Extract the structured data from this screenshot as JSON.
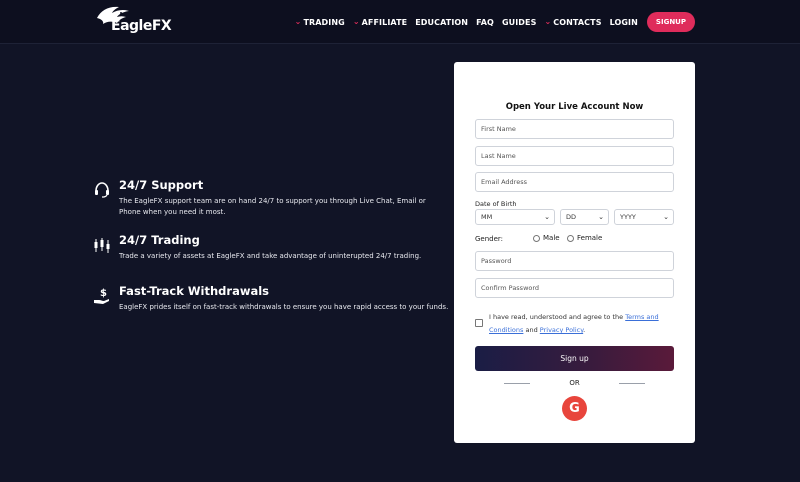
{
  "brand": {
    "name": "EagleFX"
  },
  "nav": {
    "items": [
      {
        "label": "TRADING",
        "has_dropdown": true
      },
      {
        "label": "AFFILIATE",
        "has_dropdown": true
      },
      {
        "label": "EDUCATION",
        "has_dropdown": false
      },
      {
        "label": "FAQ",
        "has_dropdown": false
      },
      {
        "label": "GUIDES",
        "has_dropdown": false
      },
      {
        "label": "CONTACTS",
        "has_dropdown": true
      },
      {
        "label": "LOGIN",
        "has_dropdown": false
      }
    ],
    "signup_label": "SIGNUP"
  },
  "features": [
    {
      "title": "24/7 Support",
      "icon": "headset-icon",
      "description": "The EagleFX support team are on hand 24/7 to support you through Live Chat, Email or Phone when you need it most."
    },
    {
      "title": "24/7 Trading",
      "icon": "candlestick-icon",
      "description": "Trade a variety of assets at EagleFX and take advantage of uninterupted 24/7 trading."
    },
    {
      "title": "Fast-Track Withdrawals",
      "icon": "dollar-hand-icon",
      "description": "EagleFX prides itself on fast-track withdrawals to ensure you have rapid access to your funds."
    }
  ],
  "form": {
    "title": "Open Your Live Account Now",
    "first_name_placeholder": "First Name",
    "last_name_placeholder": "Last Name",
    "email_placeholder": "Email Address",
    "dob_label": "Date of Birth",
    "dob_month": "MM",
    "dob_day": "DD",
    "dob_year": "YYYY",
    "gender_label": "Gender:",
    "gender_male": "Male",
    "gender_female": "Female",
    "password_placeholder": "Password",
    "confirm_password_placeholder": "Confirm Password",
    "terms_prefix": "I have read, understood and agree to the ",
    "terms_link": "Terms and Conditions",
    "terms_middle": " and ",
    "privacy_link": "Privacy Policy",
    "terms_suffix": ".",
    "submit_label": "Sign up",
    "or_label": "OR",
    "google_letter": "G"
  },
  "colors": {
    "background": "#111426",
    "accent": "#df2c5b",
    "google": "#e8453c",
    "link": "#3a6fd8"
  }
}
